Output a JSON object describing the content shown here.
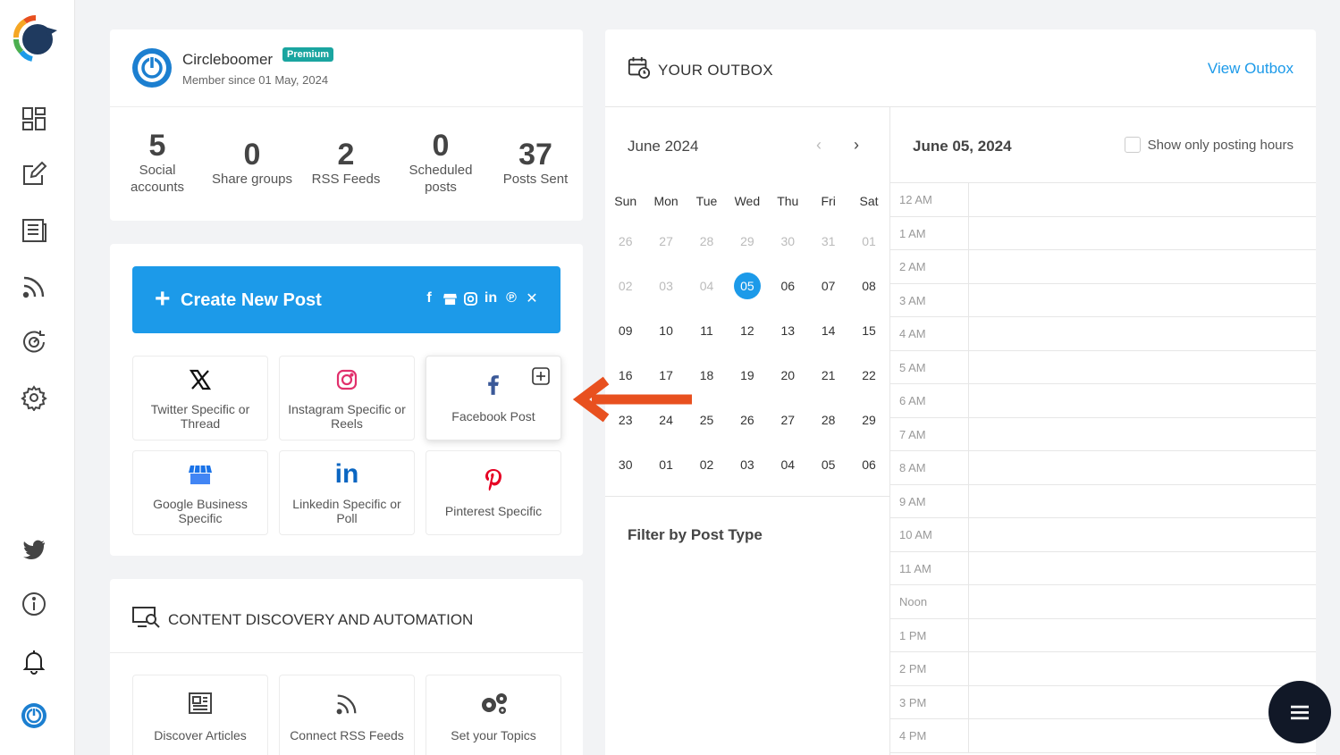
{
  "profile": {
    "name": "Circleboomer",
    "badge": "Premium",
    "member_since": "Member since 01 May, 2024"
  },
  "stats": [
    {
      "value": "5",
      "label": "Social accounts"
    },
    {
      "value": "0",
      "label": "Share groups"
    },
    {
      "value": "2",
      "label": "RSS Feeds"
    },
    {
      "value": "0",
      "label": "Scheduled posts"
    },
    {
      "value": "37",
      "label": "Posts Sent"
    }
  ],
  "create": {
    "label": "Create New Post",
    "tiles": [
      {
        "label": "Twitter Specific or Thread",
        "icon": "x-icon"
      },
      {
        "label": "Instagram Specific or Reels",
        "icon": "instagram-icon"
      },
      {
        "label": "Facebook Post",
        "icon": "facebook-icon"
      },
      {
        "label": "Google Business Specific",
        "icon": "google-business-icon"
      },
      {
        "label": "Linkedin Specific or Poll",
        "icon": "linkedin-icon"
      },
      {
        "label": "Pinterest Specific",
        "icon": "pinterest-icon"
      }
    ]
  },
  "discovery": {
    "title": "CONTENT DISCOVERY AND AUTOMATION",
    "tiles": [
      {
        "label": "Discover Articles",
        "icon": "newspaper-icon"
      },
      {
        "label": "Connect RSS Feeds",
        "icon": "rss-icon"
      },
      {
        "label": "Set your Topics",
        "icon": "gears-icon"
      }
    ]
  },
  "outbox": {
    "title": "YOUR OUTBOX",
    "view_link": "View Outbox",
    "month": "June 2024",
    "weekdays": [
      "Sun",
      "Mon",
      "Tue",
      "Wed",
      "Thu",
      "Fri",
      "Sat"
    ],
    "weeks": [
      [
        "26",
        "27",
        "28",
        "29",
        "30",
        "31",
        "01"
      ],
      [
        "02",
        "03",
        "04",
        "05",
        "06",
        "07",
        "08"
      ],
      [
        "09",
        "10",
        "11",
        "12",
        "13",
        "14",
        "15"
      ],
      [
        "16",
        "17",
        "18",
        "19",
        "20",
        "21",
        "22"
      ],
      [
        "23",
        "24",
        "25",
        "26",
        "27",
        "28",
        "29"
      ],
      [
        "30",
        "01",
        "02",
        "03",
        "04",
        "05",
        "06"
      ]
    ],
    "selected_day": "05",
    "filter_title": "Filter by Post Type",
    "day_title": "June 05, 2024",
    "posting_hours_label": "Show only posting hours",
    "hours": [
      "12 AM",
      "1 AM",
      "2 AM",
      "3 AM",
      "4 AM",
      "5 AM",
      "6 AM",
      "7 AM",
      "8 AM",
      "9 AM",
      "10 AM",
      "11 AM",
      "Noon",
      "1 PM",
      "2 PM",
      "3 PM",
      "4 PM"
    ]
  },
  "colors": {
    "accent": "#1c9ae9",
    "badge": "#1aa5a0",
    "arrow": "#e8501f",
    "fab": "#111827"
  }
}
